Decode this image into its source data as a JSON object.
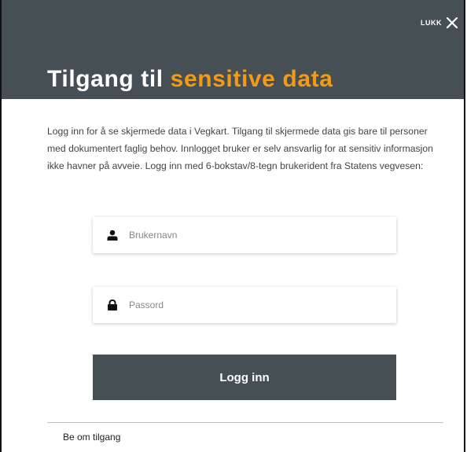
{
  "dialog": {
    "close_label": "LUKK",
    "title_plain": "Tilgang til",
    "title_accent": "sensitive data",
    "accent_color": "#f49b16",
    "header_color": "#464f54",
    "intro_text": "Logg inn for å se skjermede data i Vegkart. Tilgang til skjermede data gis bare til personer med dokumentert faglig behov. Innlogget bruker er selv ansvarlig for at sensitiv informasjon ikke havner på avveie. Logg inn med 6-bokstav/8-tegn brukerident fra Statens vegvesen:"
  },
  "form": {
    "username": {
      "placeholder": "Brukernavn",
      "value": "",
      "icon": "user-icon"
    },
    "password": {
      "placeholder": "Passord",
      "value": "",
      "icon": "lock-icon"
    },
    "submit_label": "Logg inn"
  },
  "footer": {
    "request_access_label": "Be om tilgang"
  }
}
